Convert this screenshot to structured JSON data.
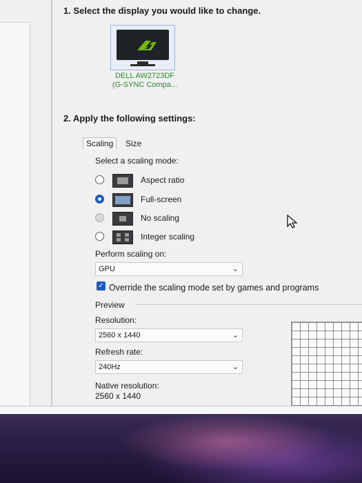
{
  "section1": {
    "heading": "1. Select the display you would like to change."
  },
  "display": {
    "name_line1": "DELL AW2723DF",
    "name_line2": "(G-SYNC Compa..."
  },
  "section2": {
    "heading": "2. Apply the following settings:"
  },
  "tabs": [
    {
      "label": "Scaling",
      "active": true
    },
    {
      "label": "Size",
      "active": false
    }
  ],
  "scaling": {
    "prompt": "Select a scaling mode:",
    "options": [
      {
        "label": "Aspect ratio",
        "selected": false,
        "enabled": true
      },
      {
        "label": "Full-screen",
        "selected": true,
        "enabled": true
      },
      {
        "label": "No scaling",
        "selected": false,
        "enabled": false
      },
      {
        "label": "Integer scaling",
        "selected": false,
        "enabled": true
      }
    ],
    "perform_label": "Perform scaling on:",
    "perform_value": "GPU",
    "override_label": "Override the scaling mode set by games and programs",
    "override_checked": true
  },
  "preview": {
    "label": "Preview",
    "resolution_label": "Resolution:",
    "resolution_value": "2560 x 1440",
    "refresh_label": "Refresh rate:",
    "refresh_value": "240Hz",
    "native_label": "Native resolution:",
    "native_value": "2560 x 1440"
  },
  "icons": {
    "monitor": "monitor-icon",
    "nvidia_logo": "nvidia-logo",
    "dropdown_arrow": "chevron-down-icon",
    "cursor": "mouse-pointer-icon"
  },
  "colors": {
    "accent": "#1e5bbf",
    "display_name": "#2d8a2d",
    "nvidia_green": "#76b900"
  }
}
